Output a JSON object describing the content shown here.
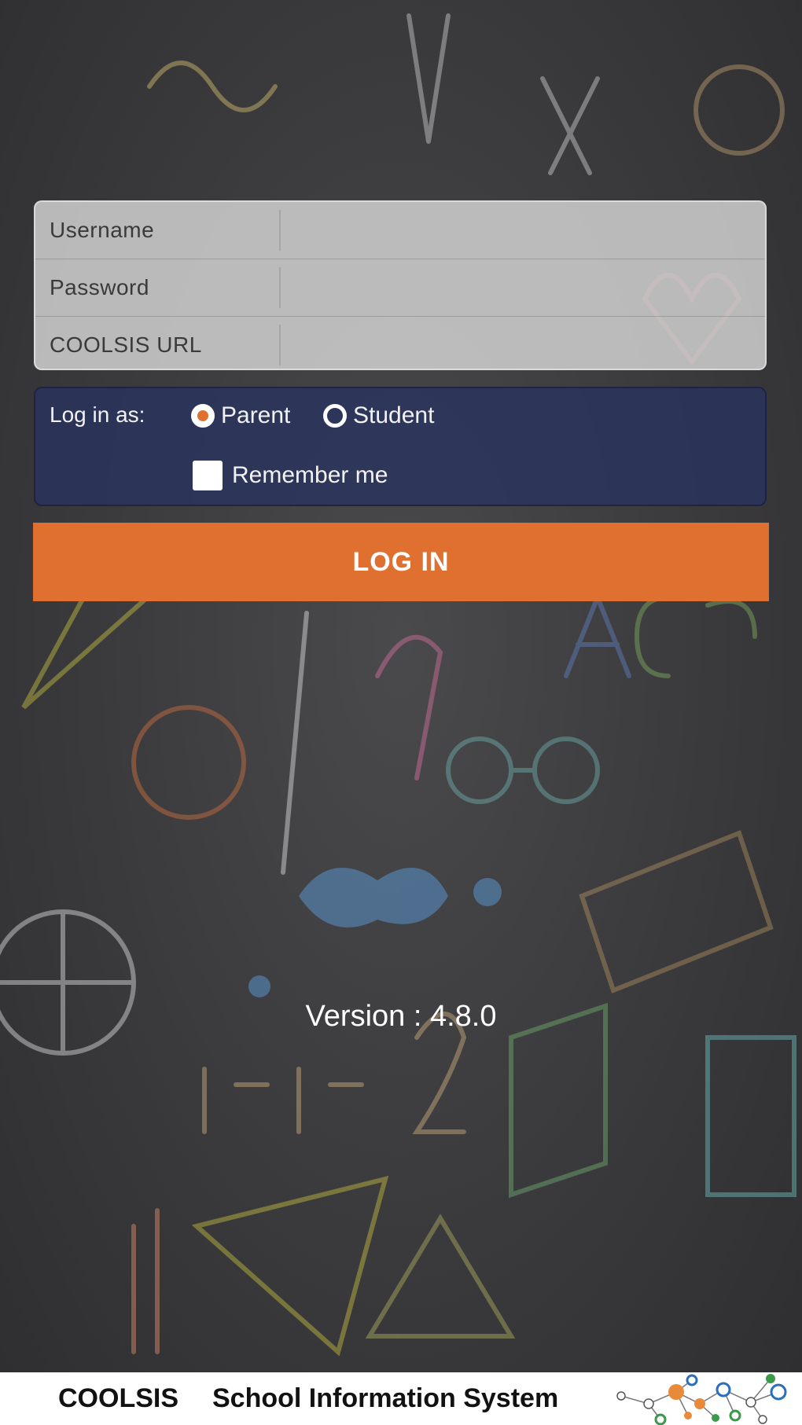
{
  "login_fields": [
    {
      "label": "Username",
      "value": "",
      "placeholder": ""
    },
    {
      "label": "Password",
      "value": "",
      "placeholder": ""
    },
    {
      "label": "COOLSIS URL",
      "value": "",
      "placeholder": ""
    }
  ],
  "role": {
    "label": "Log in as:",
    "options": [
      {
        "label": "Parent",
        "selected": true
      },
      {
        "label": "Student",
        "selected": false
      }
    ],
    "remember_label": "Remember me",
    "remember_checked": false
  },
  "login_button": "LOG IN",
  "version": "Version : 4.8.0",
  "footer": {
    "brand": "COOLSIS",
    "subtitle": "School Information System"
  },
  "colors": {
    "accent": "#e07030",
    "panel": "#28325f",
    "background": "#3a3a3c"
  }
}
